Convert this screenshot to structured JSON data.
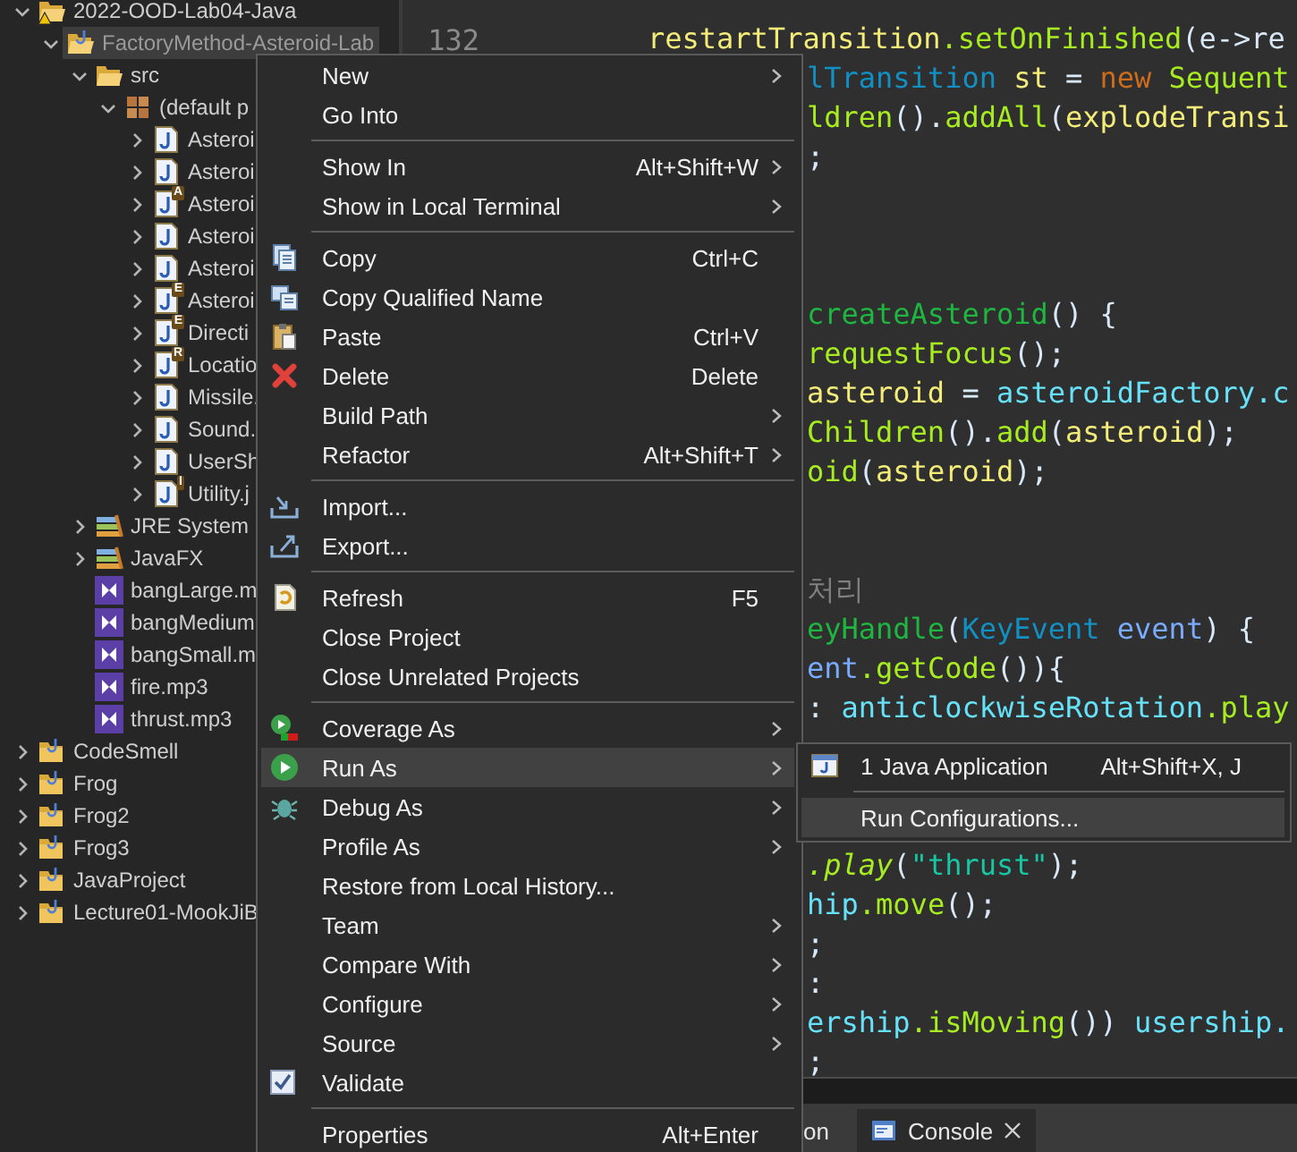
{
  "explorer": {
    "items": [
      {
        "label": "2022-OOD-Lab04-Java",
        "kind": "project",
        "warning": true,
        "expanded": true,
        "selected": false,
        "children": [
          {
            "label": "FactoryMethod-Asteroid-Lab",
            "kind": "java-project",
            "expanded": true,
            "selected": true,
            "children": [
              {
                "label": "src",
                "kind": "source-folder",
                "expanded": true,
                "selected": false,
                "children": [
                  {
                    "label": "(default p",
                    "kind": "package",
                    "expanded": true,
                    "selected": false,
                    "children": [
                      {
                        "label": "Asteroi",
                        "kind": "java",
                        "expanded": false,
                        "selected": false
                      },
                      {
                        "label": "Asteroi",
                        "kind": "java",
                        "expanded": false,
                        "selected": false
                      },
                      {
                        "label": "Asteroi",
                        "kind": "java",
                        "badge": "A",
                        "expanded": false,
                        "selected": false
                      },
                      {
                        "label": "Asteroi",
                        "kind": "java",
                        "expanded": false,
                        "selected": false
                      },
                      {
                        "label": "Asteroi",
                        "kind": "java",
                        "expanded": false,
                        "selected": false
                      },
                      {
                        "label": "Asteroi",
                        "kind": "java",
                        "badge": "E",
                        "expanded": false,
                        "selected": false
                      },
                      {
                        "label": "Directi",
                        "kind": "java",
                        "badge": "E",
                        "expanded": false,
                        "selected": false
                      },
                      {
                        "label": "Locatio",
                        "kind": "java",
                        "badge": "R",
                        "expanded": false,
                        "selected": false
                      },
                      {
                        "label": "Missile.",
                        "kind": "java",
                        "expanded": false,
                        "selected": false
                      },
                      {
                        "label": "Sound.",
                        "kind": "java",
                        "expanded": false,
                        "selected": false
                      },
                      {
                        "label": "UserSh",
                        "kind": "java",
                        "expanded": false,
                        "selected": false
                      },
                      {
                        "label": "Utility.j",
                        "kind": "java",
                        "badge": "I",
                        "expanded": false,
                        "selected": false
                      }
                    ]
                  }
                ]
              },
              {
                "label": "JRE System",
                "kind": "library",
                "expanded": false,
                "selected": false
              },
              {
                "label": "JavaFX",
                "kind": "library",
                "expanded": false,
                "selected": false
              },
              {
                "label": "bangLarge.m",
                "kind": "media",
                "selected": false
              },
              {
                "label": "bangMedium",
                "kind": "media",
                "selected": false
              },
              {
                "label": "bangSmall.m",
                "kind": "media",
                "selected": false
              },
              {
                "label": "fire.mp3",
                "kind": "media",
                "selected": false
              },
              {
                "label": "thrust.mp3",
                "kind": "media",
                "selected": false
              }
            ]
          }
        ]
      },
      {
        "label": "CodeSmell",
        "kind": "java-project",
        "expanded": false,
        "selected": false
      },
      {
        "label": "Frog",
        "kind": "java-project",
        "expanded": false,
        "selected": false
      },
      {
        "label": "Frog2",
        "kind": "java-project",
        "expanded": false,
        "selected": false
      },
      {
        "label": "Frog3",
        "kind": "java-project",
        "expanded": false,
        "selected": false
      },
      {
        "label": "JavaProject",
        "kind": "java-project",
        "expanded": false,
        "selected": false
      },
      {
        "label": "Lecture01-MookJiB",
        "kind": "java-project",
        "expanded": false,
        "selected": false
      }
    ]
  },
  "editor": {
    "lines": [
      {
        "number": "132",
        "segments": [
          {
            "kind": "local",
            "text": "restartTransition"
          },
          {
            "kind": "method",
            "text": ".setOnFinished"
          },
          {
            "kind": "plain",
            "text": "(e->re"
          }
        ]
      },
      {
        "segments": [
          {
            "kind": "type",
            "text": "lTransition "
          },
          {
            "kind": "local",
            "text": "st"
          },
          {
            "kind": "plain",
            "text": " = "
          },
          {
            "kind": "keyword",
            "text": "new "
          },
          {
            "kind": "method",
            "text": "Sequent"
          }
        ]
      },
      {
        "segments": [
          {
            "kind": "method",
            "text": "ldren"
          },
          {
            "kind": "plain",
            "text": "()."
          },
          {
            "kind": "method",
            "text": "addAll"
          },
          {
            "kind": "plain",
            "text": "("
          },
          {
            "kind": "local",
            "text": "explodeTransi"
          }
        ]
      },
      {
        "segments": [
          {
            "kind": "plain",
            "text": ";"
          }
        ]
      },
      {
        "kind": "blank"
      },
      {
        "kind": "blank"
      },
      {
        "kind": "blank"
      },
      {
        "segments": [
          {
            "kind": "decl",
            "text": "createAsteroid"
          },
          {
            "kind": "plain",
            "text": "() {"
          }
        ]
      },
      {
        "segments": [
          {
            "kind": "method",
            "text": "requestFocus"
          },
          {
            "kind": "plain",
            "text": "();"
          }
        ]
      },
      {
        "segments": [
          {
            "kind": "local",
            "text": "asteroid"
          },
          {
            "kind": "plain",
            "text": " = "
          },
          {
            "kind": "field",
            "text": "asteroidFactory.c"
          }
        ]
      },
      {
        "segments": [
          {
            "kind": "method",
            "text": "Children"
          },
          {
            "kind": "plain",
            "text": "()."
          },
          {
            "kind": "method",
            "text": "add"
          },
          {
            "kind": "plain",
            "text": "("
          },
          {
            "kind": "local",
            "text": "asteroid"
          },
          {
            "kind": "plain",
            "text": ");"
          }
        ]
      },
      {
        "segments": [
          {
            "kind": "method",
            "text": "oid"
          },
          {
            "kind": "plain",
            "text": "("
          },
          {
            "kind": "local",
            "text": "asteroid"
          },
          {
            "kind": "plain",
            "text": ");"
          }
        ]
      },
      {
        "kind": "blank"
      },
      {
        "kind": "blank"
      },
      {
        "segments": [
          {
            "kind": "comment",
            "text": "처리"
          }
        ]
      },
      {
        "segments": [
          {
            "kind": "decl",
            "text": "eyHandle"
          },
          {
            "kind": "plain",
            "text": "("
          },
          {
            "kind": "type",
            "text": "KeyEvent "
          },
          {
            "kind": "param",
            "text": "event"
          },
          {
            "kind": "plain",
            "text": ") {"
          }
        ]
      },
      {
        "segments": [
          {
            "kind": "param",
            "text": "ent"
          },
          {
            "kind": "method",
            "text": ".getCode"
          },
          {
            "kind": "plain",
            "text": "()){"
          }
        ]
      },
      {
        "segments": [
          {
            "kind": "plain",
            "text": ": "
          },
          {
            "kind": "field",
            "text": "anticlockwiseRotation"
          },
          {
            "kind": "method",
            "text": ".play"
          }
        ]
      },
      {
        "kind": "blank"
      },
      {
        "kind": "blank"
      },
      {
        "kind": "blank"
      },
      {
        "segments": [
          {
            "kind": "static",
            "text": ".play"
          },
          {
            "kind": "plain",
            "text": "("
          },
          {
            "kind": "string",
            "text": "\"thrust\""
          },
          {
            "kind": "plain",
            "text": ");"
          }
        ]
      },
      {
        "segments": [
          {
            "kind": "field",
            "text": "hip"
          },
          {
            "kind": "method",
            "text": ".move"
          },
          {
            "kind": "plain",
            "text": "();"
          }
        ]
      },
      {
        "segments": [
          {
            "kind": "plain",
            "text": ";"
          }
        ]
      },
      {
        "segments": [
          {
            "kind": "plain",
            "text": ":"
          }
        ]
      },
      {
        "segments": [
          {
            "kind": "field",
            "text": "ership"
          },
          {
            "kind": "method",
            "text": ".isMoving"
          },
          {
            "kind": "plain",
            "text": "()) "
          },
          {
            "kind": "field",
            "text": "usership."
          }
        ]
      },
      {
        "segments": [
          {
            "kind": "plain",
            "text": ";"
          }
        ]
      }
    ]
  },
  "bottom_tabs": [
    {
      "label": "on",
      "selected": false
    },
    {
      "label": "Console",
      "kind": "console",
      "selected": true,
      "closable": true
    }
  ],
  "context_menu": {
    "items": [
      {
        "kind": "item",
        "label": "New",
        "submenu": true,
        "selected": false
      },
      {
        "kind": "item",
        "label": "Go Into",
        "selected": false
      },
      {
        "kind": "separator"
      },
      {
        "kind": "item",
        "label": "Show In",
        "shortcut": "Alt+Shift+W",
        "submenu": true,
        "selected": false
      },
      {
        "kind": "item",
        "label": "Show in Local Terminal",
        "submenu": true,
        "selected": false
      },
      {
        "kind": "separator"
      },
      {
        "kind": "copy",
        "label": "Copy",
        "shortcut": "Ctrl+C",
        "selected": false
      },
      {
        "kind": "copy-qualified",
        "label": "Copy Qualified Name",
        "selected": false
      },
      {
        "kind": "paste",
        "label": "Paste",
        "shortcut": "Ctrl+V",
        "selected": false
      },
      {
        "kind": "delete",
        "label": "Delete",
        "shortcut": "Delete",
        "selected": false
      },
      {
        "kind": "item",
        "label": "Build Path",
        "submenu": true,
        "selected": false
      },
      {
        "kind": "item",
        "label": "Refactor",
        "shortcut": "Alt+Shift+T",
        "submenu": true,
        "selected": false
      },
      {
        "kind": "separator"
      },
      {
        "kind": "import",
        "label": "Import...",
        "selected": false
      },
      {
        "kind": "export",
        "label": "Export...",
        "selected": false
      },
      {
        "kind": "separator"
      },
      {
        "kind": "refresh",
        "label": "Refresh",
        "shortcut": "F5",
        "selected": false
      },
      {
        "kind": "item",
        "label": "Close Project",
        "selected": false
      },
      {
        "kind": "item",
        "label": "Close Unrelated Projects",
        "selected": false
      },
      {
        "kind": "separator"
      },
      {
        "kind": "coverage",
        "label": "Coverage As",
        "submenu": true,
        "selected": false
      },
      {
        "kind": "run",
        "label": "Run As",
        "submenu": true,
        "selected": true
      },
      {
        "kind": "debug",
        "label": "Debug As",
        "submenu": true,
        "selected": false
      },
      {
        "kind": "item",
        "label": "Profile As",
        "submenu": true,
        "selected": false
      },
      {
        "kind": "item",
        "label": "Restore from Local History...",
        "selected": false
      },
      {
        "kind": "item",
        "label": "Team",
        "submenu": true,
        "selected": false
      },
      {
        "kind": "item",
        "label": "Compare With",
        "submenu": true,
        "selected": false
      },
      {
        "kind": "item",
        "label": "Configure",
        "submenu": true,
        "selected": false
      },
      {
        "kind": "item",
        "label": "Source",
        "submenu": true,
        "selected": false
      },
      {
        "kind": "validate",
        "label": "Validate",
        "selected": false
      },
      {
        "kind": "separator"
      },
      {
        "kind": "item",
        "label": "Properties",
        "shortcut": "Alt+Enter",
        "selected": false
      }
    ]
  },
  "submenu": {
    "items": [
      {
        "kind": "java-app",
        "label": "1 Java Application",
        "shortcut": "Alt+Shift+X, J",
        "selected": false
      },
      {
        "kind": "separator"
      },
      {
        "kind": "item",
        "label": "Run Configurations...",
        "selected": true
      }
    ]
  }
}
